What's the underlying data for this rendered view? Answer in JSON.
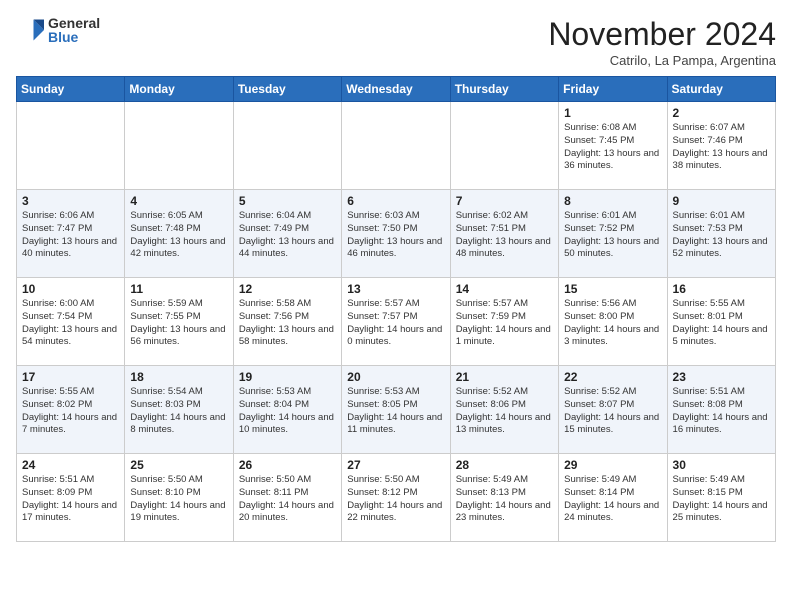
{
  "logo": {
    "general": "General",
    "blue": "Blue"
  },
  "title": "November 2024",
  "subtitle": "Catrilo, La Pampa, Argentina",
  "days_of_week": [
    "Sunday",
    "Monday",
    "Tuesday",
    "Wednesday",
    "Thursday",
    "Friday",
    "Saturday"
  ],
  "weeks": [
    [
      {
        "day": "",
        "info": ""
      },
      {
        "day": "",
        "info": ""
      },
      {
        "day": "",
        "info": ""
      },
      {
        "day": "",
        "info": ""
      },
      {
        "day": "",
        "info": ""
      },
      {
        "day": "1",
        "info": "Sunrise: 6:08 AM\nSunset: 7:45 PM\nDaylight: 13 hours and 36 minutes."
      },
      {
        "day": "2",
        "info": "Sunrise: 6:07 AM\nSunset: 7:46 PM\nDaylight: 13 hours and 38 minutes."
      }
    ],
    [
      {
        "day": "3",
        "info": "Sunrise: 6:06 AM\nSunset: 7:47 PM\nDaylight: 13 hours and 40 minutes."
      },
      {
        "day": "4",
        "info": "Sunrise: 6:05 AM\nSunset: 7:48 PM\nDaylight: 13 hours and 42 minutes."
      },
      {
        "day": "5",
        "info": "Sunrise: 6:04 AM\nSunset: 7:49 PM\nDaylight: 13 hours and 44 minutes."
      },
      {
        "day": "6",
        "info": "Sunrise: 6:03 AM\nSunset: 7:50 PM\nDaylight: 13 hours and 46 minutes."
      },
      {
        "day": "7",
        "info": "Sunrise: 6:02 AM\nSunset: 7:51 PM\nDaylight: 13 hours and 48 minutes."
      },
      {
        "day": "8",
        "info": "Sunrise: 6:01 AM\nSunset: 7:52 PM\nDaylight: 13 hours and 50 minutes."
      },
      {
        "day": "9",
        "info": "Sunrise: 6:01 AM\nSunset: 7:53 PM\nDaylight: 13 hours and 52 minutes."
      }
    ],
    [
      {
        "day": "10",
        "info": "Sunrise: 6:00 AM\nSunset: 7:54 PM\nDaylight: 13 hours and 54 minutes."
      },
      {
        "day": "11",
        "info": "Sunrise: 5:59 AM\nSunset: 7:55 PM\nDaylight: 13 hours and 56 minutes."
      },
      {
        "day": "12",
        "info": "Sunrise: 5:58 AM\nSunset: 7:56 PM\nDaylight: 13 hours and 58 minutes."
      },
      {
        "day": "13",
        "info": "Sunrise: 5:57 AM\nSunset: 7:57 PM\nDaylight: 14 hours and 0 minutes."
      },
      {
        "day": "14",
        "info": "Sunrise: 5:57 AM\nSunset: 7:59 PM\nDaylight: 14 hours and 1 minute."
      },
      {
        "day": "15",
        "info": "Sunrise: 5:56 AM\nSunset: 8:00 PM\nDaylight: 14 hours and 3 minutes."
      },
      {
        "day": "16",
        "info": "Sunrise: 5:55 AM\nSunset: 8:01 PM\nDaylight: 14 hours and 5 minutes."
      }
    ],
    [
      {
        "day": "17",
        "info": "Sunrise: 5:55 AM\nSunset: 8:02 PM\nDaylight: 14 hours and 7 minutes."
      },
      {
        "day": "18",
        "info": "Sunrise: 5:54 AM\nSunset: 8:03 PM\nDaylight: 14 hours and 8 minutes."
      },
      {
        "day": "19",
        "info": "Sunrise: 5:53 AM\nSunset: 8:04 PM\nDaylight: 14 hours and 10 minutes."
      },
      {
        "day": "20",
        "info": "Sunrise: 5:53 AM\nSunset: 8:05 PM\nDaylight: 14 hours and 11 minutes."
      },
      {
        "day": "21",
        "info": "Sunrise: 5:52 AM\nSunset: 8:06 PM\nDaylight: 14 hours and 13 minutes."
      },
      {
        "day": "22",
        "info": "Sunrise: 5:52 AM\nSunset: 8:07 PM\nDaylight: 14 hours and 15 minutes."
      },
      {
        "day": "23",
        "info": "Sunrise: 5:51 AM\nSunset: 8:08 PM\nDaylight: 14 hours and 16 minutes."
      }
    ],
    [
      {
        "day": "24",
        "info": "Sunrise: 5:51 AM\nSunset: 8:09 PM\nDaylight: 14 hours and 17 minutes."
      },
      {
        "day": "25",
        "info": "Sunrise: 5:50 AM\nSunset: 8:10 PM\nDaylight: 14 hours and 19 minutes."
      },
      {
        "day": "26",
        "info": "Sunrise: 5:50 AM\nSunset: 8:11 PM\nDaylight: 14 hours and 20 minutes."
      },
      {
        "day": "27",
        "info": "Sunrise: 5:50 AM\nSunset: 8:12 PM\nDaylight: 14 hours and 22 minutes."
      },
      {
        "day": "28",
        "info": "Sunrise: 5:49 AM\nSunset: 8:13 PM\nDaylight: 14 hours and 23 minutes."
      },
      {
        "day": "29",
        "info": "Sunrise: 5:49 AM\nSunset: 8:14 PM\nDaylight: 14 hours and 24 minutes."
      },
      {
        "day": "30",
        "info": "Sunrise: 5:49 AM\nSunset: 8:15 PM\nDaylight: 14 hours and 25 minutes."
      }
    ]
  ]
}
